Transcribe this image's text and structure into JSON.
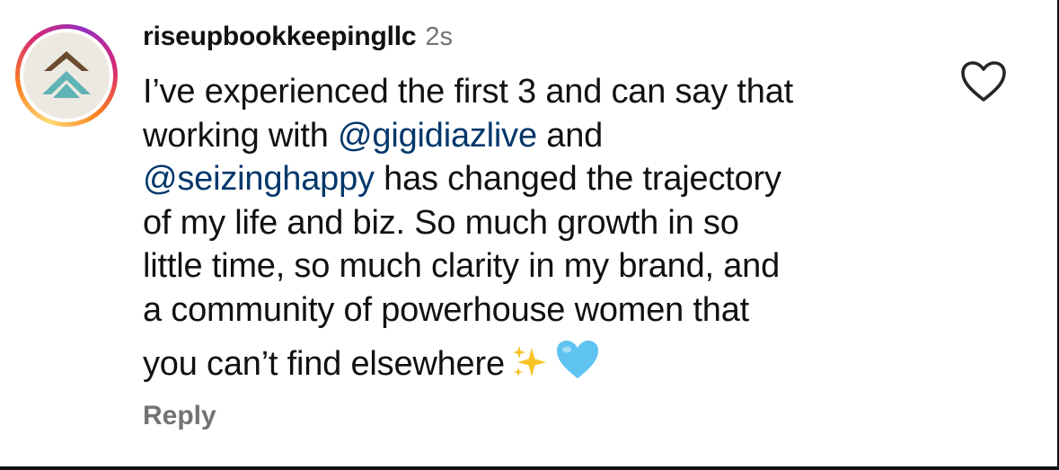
{
  "comment": {
    "username": "riseupbookkeepingllc",
    "timestamp": "2s",
    "lines": [
      [
        {
          "t": "I’ve experienced the first 3 and can say that"
        }
      ],
      [
        {
          "t": "working with "
        },
        {
          "m": "@gigidiazlive"
        },
        {
          "t": " and"
        }
      ],
      [
        {
          "m": "@seizinghappy"
        },
        {
          "t": " has changed the trajectory"
        }
      ],
      [
        {
          "t": "of my life and biz. So much growth in so"
        }
      ],
      [
        {
          "t": "little time, so much clarity in my brand, and"
        }
      ],
      [
        {
          "t": "a community of powerhouse women that"
        }
      ],
      [
        {
          "t": "you can’t find elsewhere"
        }
      ]
    ],
    "trailing_emojis": [
      "sparkles-emoji",
      "light-blue-heart-emoji"
    ],
    "reply_label": "Reply"
  },
  "avatar": {
    "icon": "rising-chevrons-logo",
    "upper_chevron_color": "#6b4a2f",
    "lower_chevron_color": "#5fb3b5",
    "background_color": "#ece9e1"
  },
  "like_icon": "heart-outline-icon",
  "colors": {
    "mention": "#00376b",
    "secondary_text": "#737373",
    "primary_text": "#111111"
  }
}
